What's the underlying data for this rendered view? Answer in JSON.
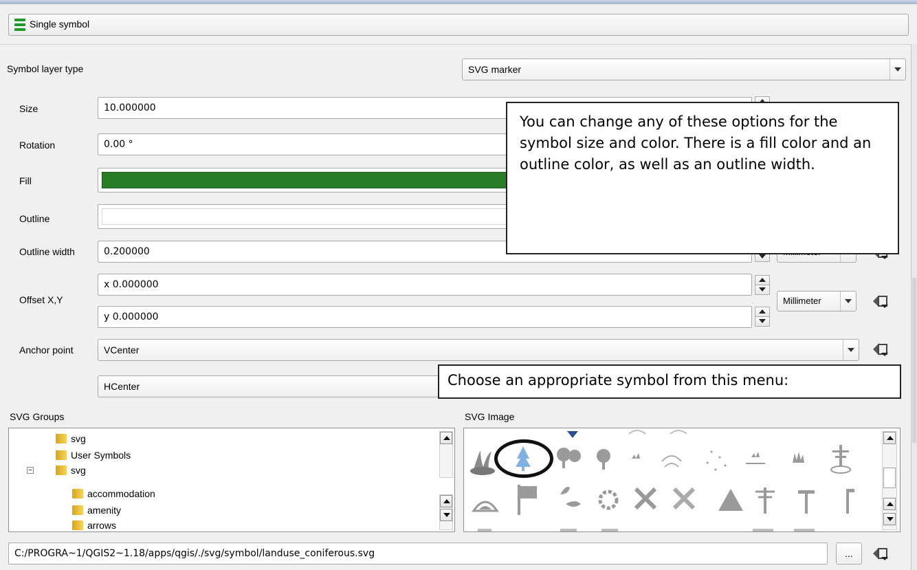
{
  "renderer": {
    "label": "Single symbol"
  },
  "symbol_layer_type": {
    "label": "Symbol layer type",
    "value": "SVG marker"
  },
  "size": {
    "label": "Size",
    "value": "10.000000"
  },
  "rotation": {
    "label": "Rotation",
    "value": "0.00 °"
  },
  "fill": {
    "label": "Fill",
    "color": "#2a7d27"
  },
  "outline": {
    "label": "Outline",
    "color": "#ffffff"
  },
  "outline_width": {
    "label": "Outline width",
    "value": "0.200000",
    "unit": "Millimeter"
  },
  "offset": {
    "label": "Offset X,Y",
    "x": "x 0.000000",
    "y": "y 0.000000",
    "unit": "Millimeter"
  },
  "anchor": {
    "label": "Anchor point",
    "vertical": "VCenter",
    "horizontal": "HCenter"
  },
  "svg_groups": {
    "label": "SVG Groups",
    "items": [
      "svg",
      "User Symbols",
      "svg",
      "accommodation",
      "amenity",
      "arrows"
    ]
  },
  "svg_image": {
    "label": "SVG Image"
  },
  "path": {
    "value": "C:/PROGRA~1/QGIS2~1.18/apps/qgis/./svg/symbol/landuse_coniferous.svg",
    "browse_label": "..."
  },
  "callouts": {
    "top": "You can change any of these options for the symbol size and color.  There is a fill color and an outline color, as well as an outline width.",
    "bottom": "Choose an appropriate symbol from this menu:"
  },
  "colors": {
    "accent_green": "#1f9a2a",
    "highlight_blue": "#7fb2e0"
  }
}
